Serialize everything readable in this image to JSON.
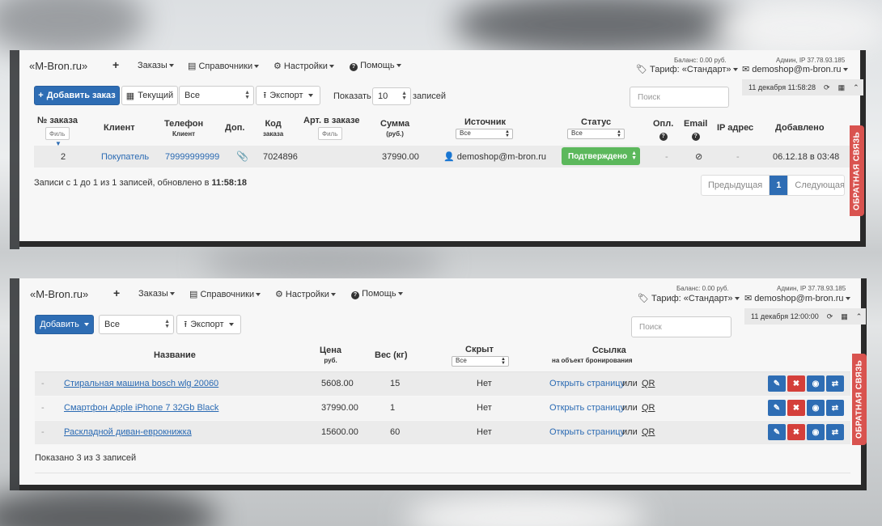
{
  "nav": {
    "brand": "«M-Bron.ru»",
    "plus": "+",
    "orders": "Заказы",
    "refs": "Справочники",
    "settings": "Настройки",
    "help": "Помощь",
    "balance": "Баланс: 0.00 руб.",
    "tariff": "Тариф: «Стандарт»",
    "admin_ip": "Админ, IP 37.78.93.185",
    "user_email": "demoshop@m-bron.ru"
  },
  "orders_panel": {
    "add_order": "Добавить заказ",
    "current": "Текущий",
    "filter_all": "Все",
    "export": "Экспорт",
    "show_label": "Показать",
    "page_size": "10",
    "records_label": "записей",
    "search_placeholder": "Поиск",
    "date_time": "11 декабря 11:58:28",
    "headers": {
      "order_no": "№ заказа",
      "client": "Клиент",
      "phone": "Телефон",
      "phone_sub": "Клиент",
      "extra": "Доп.",
      "code": "Код",
      "code_sub": "заказа",
      "article": "Арт. в заказе",
      "sum": "Сумма",
      "sum_sub": "(руб.)",
      "source": "Источник",
      "status": "Статус",
      "paid": "Опл.",
      "email": "Email",
      "ip": "IP адрес",
      "added": "Добавлено"
    },
    "filter_placeholder": "Филь",
    "source_filter": "Все",
    "status_filter": "Все",
    "row": {
      "order_no": "2",
      "client": "Покупатель",
      "phone": "79999999999",
      "code": "7024896",
      "sum": "37990.00",
      "source": "demoshop@m-bron.ru",
      "status": "Подтверждено",
      "paid": "-",
      "ip": "-",
      "added": "06.12.18 в 03:48"
    },
    "info_prefix": "Записи с 1 до 1 из 1 записей, обновлено в ",
    "info_time": "11:58:18",
    "pager": {
      "prev": "Предыдущая",
      "page": "1",
      "next": "Следующая"
    }
  },
  "products_panel": {
    "add": "Добавить",
    "filter_all": "Все",
    "export": "Экспорт",
    "search_placeholder": "Поиск",
    "date_time": "11 декабря 12:00:00",
    "headers": {
      "name": "Название",
      "price": "Цена",
      "price_sub": "руб.",
      "weight": "Вес (кг)",
      "hidden": "Скрыт",
      "link": "Ссылка",
      "link_sub": "на объект бронирования"
    },
    "hidden_filter": "Все",
    "rows": [
      {
        "dash": "-",
        "name": "Стиральная машина bosch wlg 20060",
        "price": "5608.00",
        "weight": "15",
        "hidden": "Нет",
        "open": "Открыть страницу",
        "or": "или",
        "qr": "QR"
      },
      {
        "dash": "-",
        "name": "Смартфон Apple iPhone 7 32Gb Black",
        "price": "37990.00",
        "weight": "1",
        "hidden": "Нет",
        "open": "Открыть страницу",
        "or": "или",
        "qr": "QR"
      },
      {
        "dash": "-",
        "name": "Раскладной диван-еврокнижка",
        "price": "15600.00",
        "weight": "60",
        "hidden": "Нет",
        "open": "Открыть страницу",
        "or": "или",
        "qr": "QR"
      }
    ],
    "info": "Показано 3 из 3 записей"
  },
  "feedback": "ОБРАТНАЯ СВЯЗЬ",
  "colors": {
    "primary": "#2e6db4",
    "success": "#5cb85c",
    "danger": "#d43f3a",
    "feedback": "#d9534f"
  }
}
